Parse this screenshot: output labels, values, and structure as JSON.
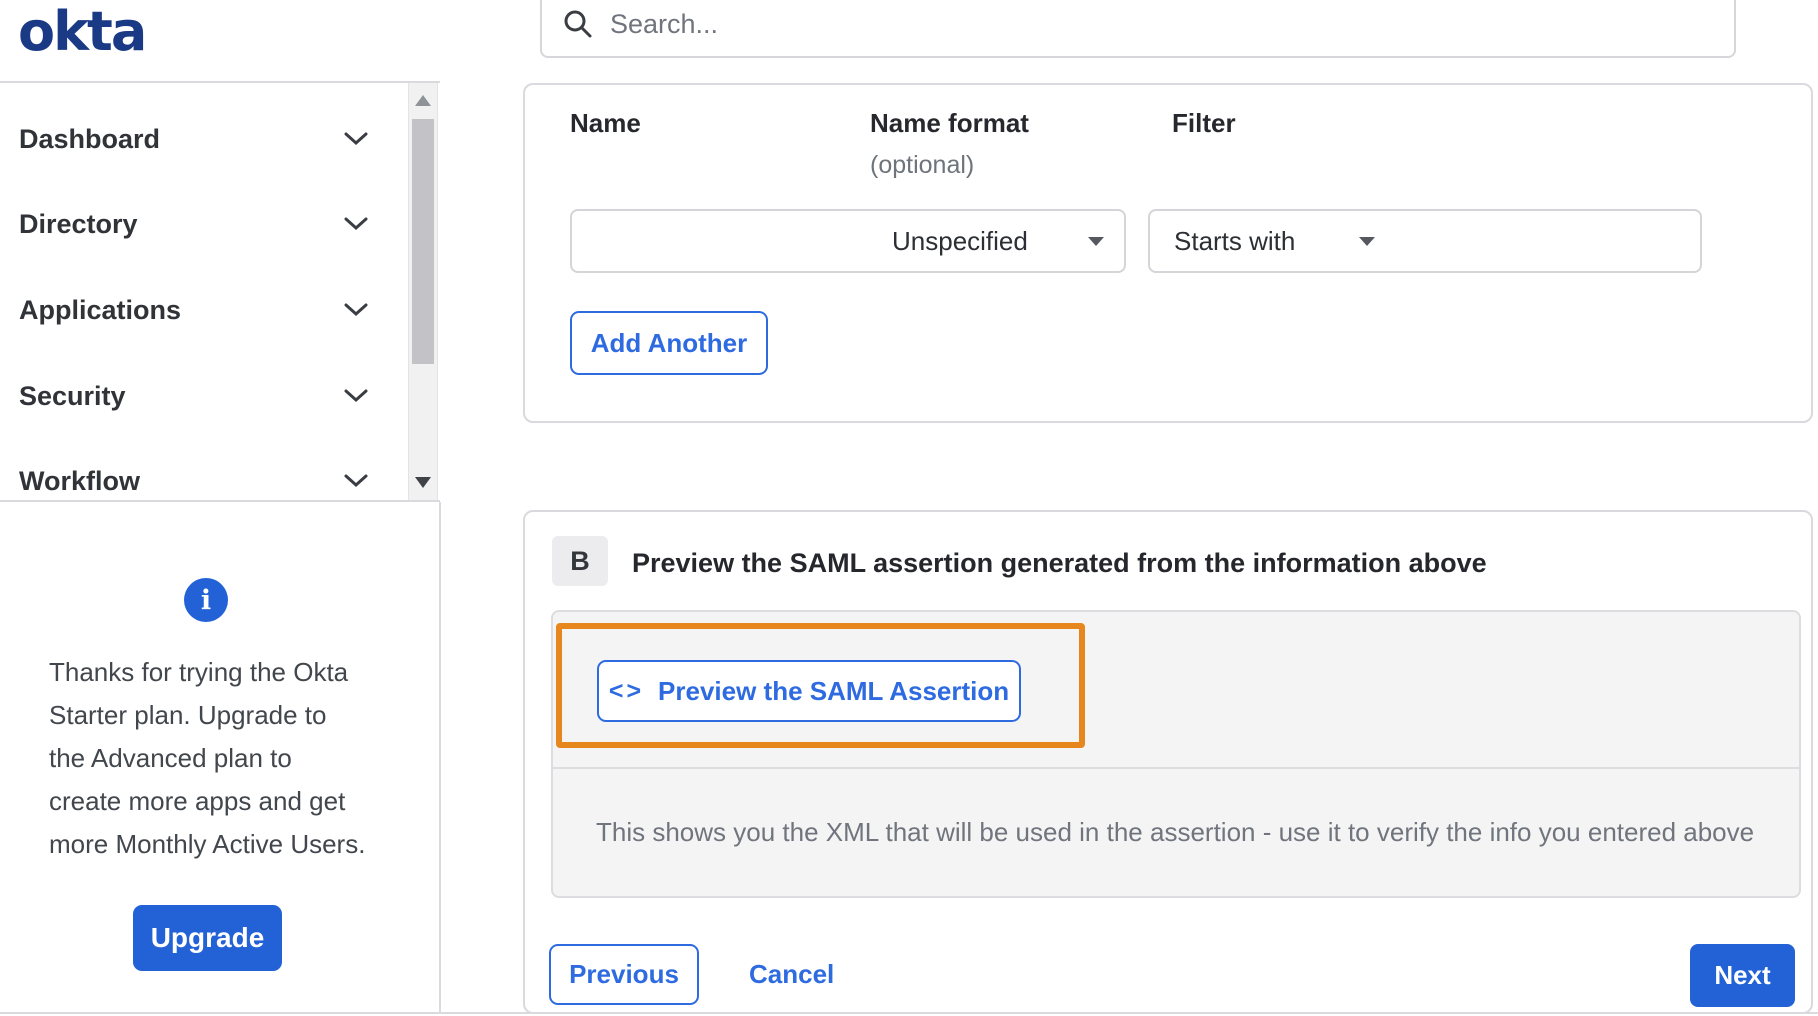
{
  "brand": {
    "logo_text": "okta",
    "logo_color": "#1b3a86"
  },
  "search": {
    "placeholder": "Search...",
    "icon": "search-icon"
  },
  "sidebar": {
    "items": [
      {
        "label": "Dashboard",
        "icon": "chevron-down-icon"
      },
      {
        "label": "Directory",
        "icon": "chevron-down-icon"
      },
      {
        "label": "Applications",
        "icon": "chevron-down-icon"
      },
      {
        "label": "Security",
        "icon": "chevron-down-icon"
      },
      {
        "label": "Workflow",
        "icon": "chevron-down-icon"
      }
    ],
    "promo": {
      "info_glyph": "i",
      "info_icon": "info-icon",
      "lines": [
        "Thanks for trying the Okta",
        "Starter plan. Upgrade to",
        "the Advanced plan to",
        "create more apps and get",
        "more Monthly Active Users."
      ],
      "upgrade_label": "Upgrade"
    }
  },
  "form": {
    "headers": {
      "name": "Name",
      "name_format": "Name format",
      "name_format_optional": "(optional)",
      "filter": "Filter"
    },
    "name_value": "",
    "name_format_value": "Unspecified",
    "filter_operator_value": "Starts with",
    "filter_value": "",
    "add_another_label": "Add Another"
  },
  "preview": {
    "badge": "B",
    "heading": "Preview the SAML assertion generated from the information above",
    "button_icon": "<>",
    "button_label": "Preview the SAML Assertion",
    "caption": "This shows you the XML that will be used in the assertion - use it to verify the info you entered above",
    "highlight_color": "#e8861e"
  },
  "footer": {
    "previous_label": "Previous",
    "cancel_label": "Cancel",
    "next_label": "Next"
  },
  "colors": {
    "accent_blue_fill": "#2262d6",
    "accent_blue_text": "#2e6ae0",
    "card_border": "#d9d9de",
    "panel_gray": "#f4f4f5",
    "text_dark": "#26282d",
    "text_gray": "#70757d"
  }
}
